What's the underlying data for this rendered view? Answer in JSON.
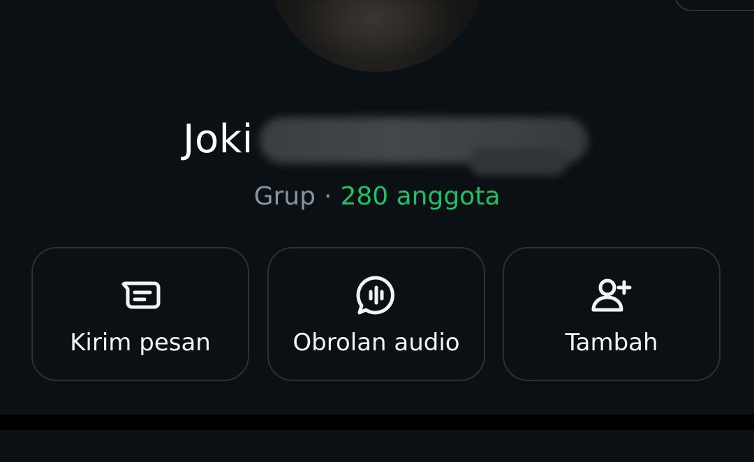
{
  "profile": {
    "name_visible": "Joki",
    "kind": "Grup",
    "separator": "·",
    "members": "280 anggota"
  },
  "actions": [
    {
      "label": "Kirim pesan",
      "icon": "message-icon"
    },
    {
      "label": "Obrolan audio",
      "icon": "audio-chat-icon"
    },
    {
      "label": "Tambah",
      "icon": "add-person-icon"
    }
  ],
  "colors": {
    "background": "#0b1014",
    "accent_green": "#21c063",
    "muted_text": "#8696a0",
    "card_border": "#2a3236"
  }
}
